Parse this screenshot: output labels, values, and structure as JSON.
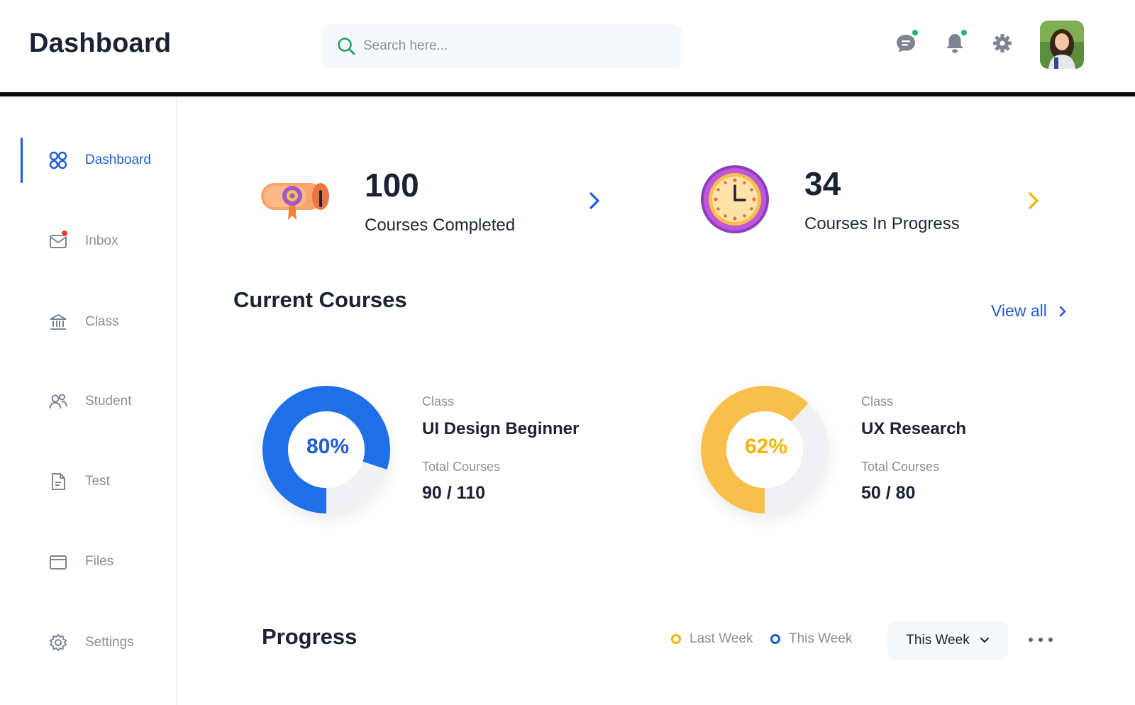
{
  "header": {
    "title": "Dashboard",
    "search_placeholder": "Search here...",
    "icons": [
      "chat-icon",
      "bell-icon",
      "gear-icon",
      "avatar"
    ]
  },
  "sidebar": {
    "items": [
      {
        "label": "Dashboard",
        "icon": "grid-icon",
        "active": true
      },
      {
        "label": "Inbox",
        "icon": "mail-icon",
        "active": false
      },
      {
        "label": "Class",
        "icon": "bank-icon",
        "active": false
      },
      {
        "label": "Student",
        "icon": "users-icon",
        "active": false
      },
      {
        "label": "Test",
        "icon": "document-icon",
        "active": false
      },
      {
        "label": "Files",
        "icon": "folder-icon",
        "active": false
      },
      {
        "label": "Settings",
        "icon": "settings-icon",
        "active": false
      }
    ]
  },
  "stats": [
    {
      "value": "100",
      "label": "Courses Completed",
      "icon": "certificate-icon",
      "chevron_color": "#1f5cd6"
    },
    {
      "value": "34",
      "label": "Courses In Progress",
      "icon": "clock-icon",
      "chevron_color": "#f4b400"
    }
  ],
  "current_courses": {
    "title": "Current Courses",
    "view_all": "View all",
    "courses": [
      {
        "percent": 80,
        "percent_label": "80%",
        "color": "#1f6fe6",
        "class_label": "Class",
        "name": "UI Design Beginner",
        "total_label": "Total Courses",
        "total": "90 / 110"
      },
      {
        "percent": 62,
        "percent_label": "62%",
        "color": "#f7c04a",
        "class_label": "Class",
        "name": "UX Research",
        "total_label": "Total Courses",
        "total": "50 / 80"
      }
    ]
  },
  "progress": {
    "title": "Progress",
    "legend": [
      {
        "label": "Last Week",
        "color": "#f4b400"
      },
      {
        "label": "This Week",
        "color": "#1f5cd6"
      }
    ],
    "selected_period": "This Week"
  },
  "colors": {
    "accent": "#1f5cd6",
    "text": "#1a2233",
    "muted": "#8b8f9a",
    "online": "#22b573",
    "alert": "#e53935"
  }
}
